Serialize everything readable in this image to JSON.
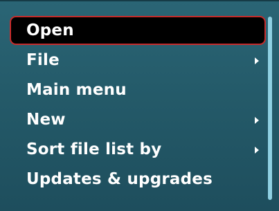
{
  "menu": {
    "items": [
      {
        "label": "Open",
        "has_submenu": false,
        "selected": true
      },
      {
        "label": "File",
        "has_submenu": true,
        "selected": false
      },
      {
        "label": "Main menu",
        "has_submenu": false,
        "selected": false
      },
      {
        "label": "New",
        "has_submenu": true,
        "selected": false
      },
      {
        "label": "Sort file list by",
        "has_submenu": true,
        "selected": false
      },
      {
        "label": "Updates & upgrades",
        "has_submenu": false,
        "selected": false
      }
    ]
  },
  "colors": {
    "background": "#245a69",
    "selection_fill": "#000000",
    "selection_border": "#c72b2b",
    "text": "#ffffff",
    "scrollbar": "#8fd0e2"
  },
  "icons": {
    "submenu_arrow": "chevron-right-icon"
  }
}
